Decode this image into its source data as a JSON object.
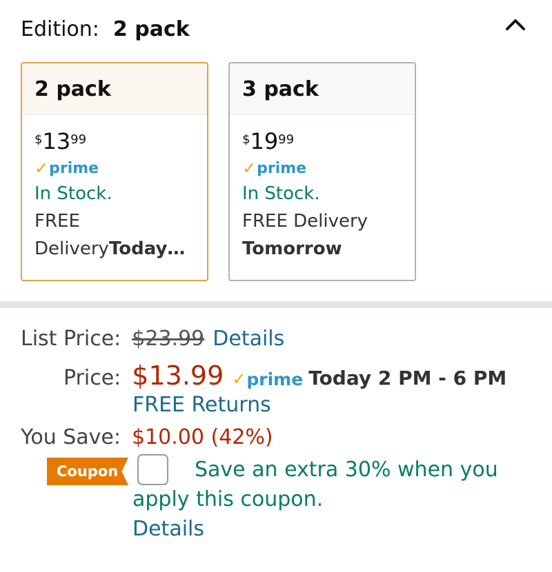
{
  "edition": {
    "label": "Edition:",
    "value": "2 pack"
  },
  "icons": {
    "collapse": "chevron-up-icon",
    "prime_check": "check-icon"
  },
  "cards": [
    {
      "name": "2 pack",
      "currency": "$",
      "whole": "13",
      "fraction": "99",
      "prime": "prime",
      "stock": "In Stock.",
      "delivery_line1": "FREE",
      "delivery_line2_prefix": "Delivery",
      "delivery_line2_bold": "Today…"
    },
    {
      "name": "3 pack",
      "currency": "$",
      "whole": "19",
      "fraction": "99",
      "prime": "prime",
      "stock": "In Stock.",
      "delivery_line1": "FREE Delivery",
      "delivery_line2_bold": "Tomorrow"
    }
  ],
  "pricing": {
    "list_label": "List Price:",
    "list_value": "$23.99",
    "list_details": "Details",
    "price_label": "Price:",
    "price_value": "$13.99",
    "prime": "prime",
    "delivery_window": "Today 2 PM - 6 PM",
    "returns": "FREE Returns",
    "save_label": "You Save:",
    "save_value": "$10.00 (42%)"
  },
  "coupon": {
    "badge": "Coupon",
    "text_line1": "Save an extra 30% when you",
    "text_line2": "apply this coupon.",
    "details": "Details"
  },
  "colors": {
    "accent_orange": "#e67a00",
    "selected_border": "#e3a14a",
    "link": "#1e6a8a",
    "green": "#067d62",
    "red": "#b12704",
    "prime_blue": "#2f96c9"
  }
}
